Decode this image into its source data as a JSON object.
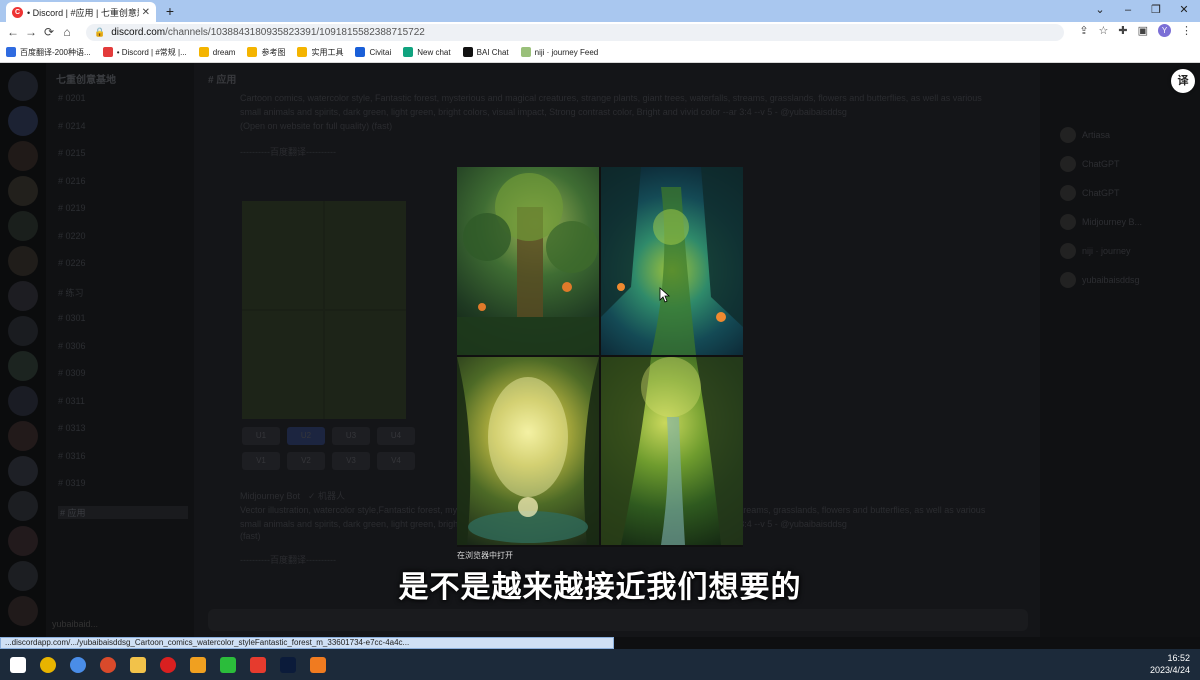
{
  "browser": {
    "tab_title": "• Discord | #应用 | 七重创意题...",
    "tab_favicon": "C",
    "new_tab": "+",
    "controls": {
      "dropdown": "⌄",
      "minimize": "–",
      "maximize": "❐",
      "close": "✕"
    },
    "nav": {
      "back": "←",
      "forward": "→",
      "reload": "⟳",
      "home": "⌂"
    },
    "url_host": "discord.com",
    "url_path": "/channels/1038843180935823391/1091815582388715722",
    "profile_initial": "Y"
  },
  "bookmarks": [
    {
      "label": "百度翻译-200种语...",
      "color": "#2f6be0"
    },
    {
      "label": "• Discord | #常规 |...",
      "color": "#e33b3b"
    },
    {
      "label": "dream",
      "color": "#f4b400"
    },
    {
      "label": "参考图",
      "color": "#f4b400"
    },
    {
      "label": "实用工具",
      "color": "#f4b400"
    },
    {
      "label": "Civitai",
      "color": "#1a5fd8"
    },
    {
      "label": "New chat",
      "color": "#10a37f"
    },
    {
      "label": "BAI Chat",
      "color": "#111111"
    },
    {
      "label": "niji · journey Feed",
      "color": "#9ac07a"
    }
  ],
  "discord": {
    "server_name": "七重创意基地",
    "channel_title": "应用",
    "channels": [
      "0201",
      "0214",
      "0215",
      "0216",
      "0219",
      "0220",
      "0226",
      "练习",
      "0301",
      "0306",
      "0309",
      "0311",
      "0313",
      "0316",
      "0319",
      "应用"
    ],
    "active_channel": "应用",
    "user": "yubaibaid...",
    "message_top": "Cartoon comics, watercolor style, Fantastic forest, mysterious and magical creatures, strange plants, giant trees, waterfalls, streams, grasslands, flowers and butterflies, as well as various small animals and spirits, dark green, light green, bright colors, visual impact, Strong contrast color, Bright and vivid color --ar 3:4 --v 5 - @yubaibaisddsg",
    "message_top_note": "(Open on website for full quality) (fast)",
    "divider_label": "----------百度翻译----------",
    "buttons_row1": [
      "U1",
      "U2",
      "U3",
      "U4"
    ],
    "buttons_row2": [
      "V1",
      "V2",
      "V3",
      "V4"
    ],
    "bot_name": "Midjourney Bot",
    "bot_badge": "✓ 机器人",
    "message_bottom": "Vector illustration, watercolor style,Fantastic forest, mysterious and magical creatures, strange plants, giant trees, waterfalls, streams, grasslands, flowers and butterflies, as well as various small animals and spirits, dark green, light green, bright colors, visual impact, Strong contrast color, Bright and vivid color --ar 3:4 --v 5 - @yubaibaisddsg",
    "message_bottom_note": "(fast)",
    "members": [
      "Artiasa",
      "ChatGPT",
      "ChatGPT",
      "Midjourney B...",
      "niji · journey",
      "yubaibaisddsg"
    ],
    "translate_button": "译"
  },
  "lightbox": {
    "open_in_browser": "在浏览器中打开",
    "tile_colors": [
      "#3f6d33",
      "#2f8a6a",
      "#b7b340",
      "#6f9c2e"
    ]
  },
  "subtitle": "是不是越来越接近我们想要的",
  "status_link": "...discordapp.com/.../yubaibaisddsg_Cartoon_comics_watercolor_styleFantastic_forest_m_33601734-e7cc-4a4c...",
  "taskbar": {
    "apps": [
      {
        "name": "windows-start",
        "color": "#ffffff"
      },
      {
        "name": "chrome",
        "color": "#e8b400"
      },
      {
        "name": "chrome-active",
        "color": "#4a8de8"
      },
      {
        "name": "chrome-2",
        "color": "#d94a2b"
      },
      {
        "name": "file-explorer",
        "color": "#f2c24a"
      },
      {
        "name": "recorder",
        "color": "#d92020"
      },
      {
        "name": "feishu",
        "color": "#f0a020"
      },
      {
        "name": "wechat",
        "color": "#2bbd3b"
      },
      {
        "name": "wps",
        "color": "#e63b2e"
      },
      {
        "name": "photoshop",
        "color": "#0b1b3a"
      },
      {
        "name": "video-player",
        "color": "#f07b20"
      }
    ],
    "time": "16:52",
    "date": "2023/4/24"
  }
}
